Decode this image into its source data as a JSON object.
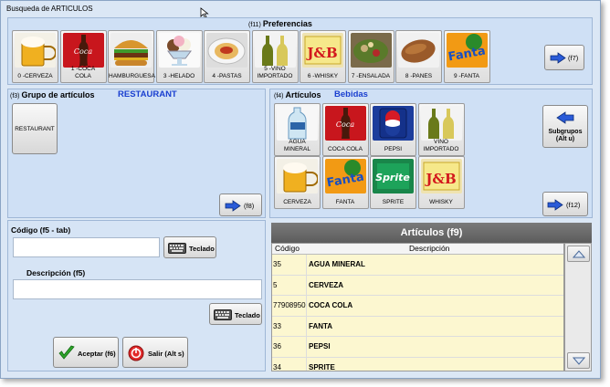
{
  "window": {
    "title": "Busqueda de ARTICULOS"
  },
  "favorites": {
    "key": "(f11)",
    "title": "Preferencias",
    "items": [
      {
        "label": "0 -CERVEZA",
        "icon": "beer-mug-icon"
      },
      {
        "label": "1 -COCA\nCOLA",
        "icon": "coca-cola-bottle-icon"
      },
      {
        "label": "HAMBURGUESA",
        "icon": "hamburger-icon"
      },
      {
        "label": "3 -HELADO",
        "icon": "ice-cream-icon"
      },
      {
        "label": "4 -PASTAS",
        "icon": "pasta-icon"
      },
      {
        "label": "5 -VINO\nIMPORTADO",
        "icon": "wine-bottles-icon"
      },
      {
        "label": "6 -WHISKY",
        "icon": "whisky-jb-icon"
      },
      {
        "label": "7 -ENSALADA",
        "icon": "salad-icon"
      },
      {
        "label": "8 -PANES",
        "icon": "bread-icon"
      },
      {
        "label": "9 -FANTA",
        "icon": "fanta-can-icon"
      }
    ],
    "next_label": "(f7)"
  },
  "groups": {
    "key": "(f3)",
    "title": "Grupo de artículos",
    "selected": "RESTAURANT",
    "items": [
      "RESTAURANT"
    ],
    "next_label": "(f8)"
  },
  "articles": {
    "key": "(f4)",
    "title": "Artículos",
    "selected": "Bebidas",
    "items": [
      {
        "label": "AGUA\nMINERAL",
        "icon": "water-bottle-icon"
      },
      {
        "label": "COCA COLA",
        "icon": "coca-cola-bottle-icon"
      },
      {
        "label": "PEPSI",
        "icon": "pepsi-can-icon"
      },
      {
        "label": "VINO\nIMPORTADO",
        "icon": "wine-bottles-icon"
      },
      {
        "label": "CERVEZA",
        "icon": "beer-mug-icon"
      },
      {
        "label": "FANTA",
        "icon": "fanta-can-icon"
      },
      {
        "label": "SPRITE",
        "icon": "sprite-can-icon"
      },
      {
        "label": "WHISKY",
        "icon": "whisky-jb-icon"
      }
    ],
    "subgroups_label": "Subgrupos\n(Alt u)",
    "next_label": "(f12)"
  },
  "search": {
    "code_label": "Código (f5 - tab)",
    "code_value": "",
    "keyboard_label": "Teclado",
    "desc_label": "Descripción (f5)",
    "desc_value": ""
  },
  "actions": {
    "accept_label": "Aceptar (f6)",
    "exit_label": "Salir (Alt s)"
  },
  "list": {
    "title": "Artículos (f9)",
    "columns": [
      "Código",
      "Descripción"
    ],
    "rows": [
      {
        "code": "35",
        "desc": "AGUA MINERAL"
      },
      {
        "code": "5",
        "desc": "CERVEZA"
      },
      {
        "code": "77908950",
        "desc": "COCA COLA"
      },
      {
        "code": "33",
        "desc": "FANTA"
      },
      {
        "code": "36",
        "desc": "PEPSI"
      },
      {
        "code": "34",
        "desc": "SPRITE"
      }
    ]
  },
  "colors": {
    "accent_blue": "#1a3fd0",
    "panel": "#cfe0f5",
    "row_bg": "#fcf7d0"
  }
}
